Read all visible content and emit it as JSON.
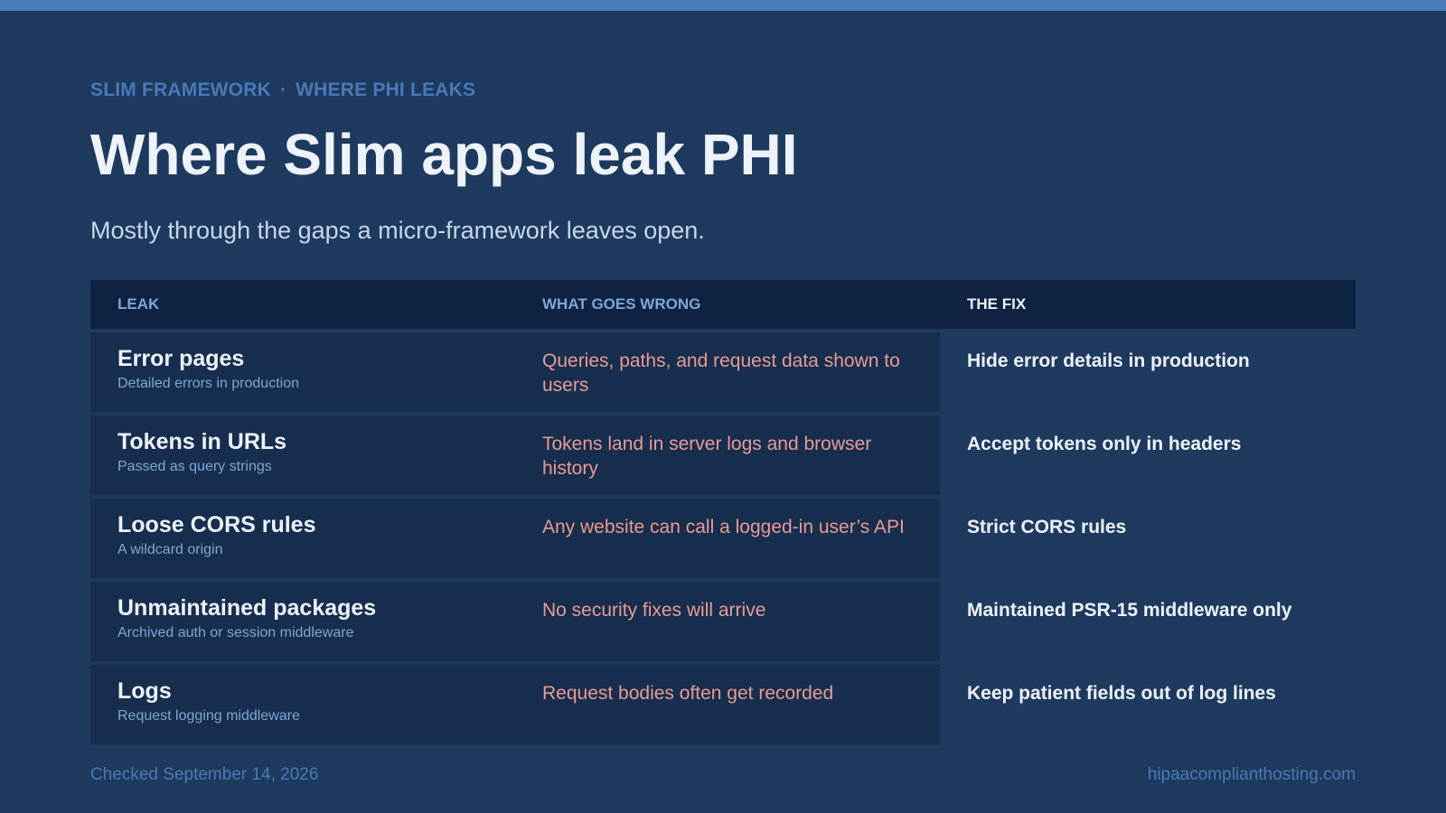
{
  "eyebrow": {
    "left": "SLIM FRAMEWORK",
    "separator": "·",
    "right": "WHERE PHI LEAKS"
  },
  "title": "Where Slim apps leak PHI",
  "subtitle": "Mostly through the gaps a micro-framework leaves open.",
  "table": {
    "headers": [
      "LEAK",
      "WHAT GOES WRONG",
      "THE FIX"
    ],
    "rows": [
      {
        "leak": "Error pages",
        "leak_detail": "Detailed errors in production",
        "problem": "Queries, paths, and request data shown to users",
        "fix": "Hide error details in production"
      },
      {
        "leak": "Tokens in URLs",
        "leak_detail": "Passed as query strings",
        "problem": "Tokens land in server logs and browser history",
        "fix": "Accept tokens only in headers"
      },
      {
        "leak": "Loose CORS rules",
        "leak_detail": "A wildcard origin",
        "problem": "Any website can call a logged-in user’s API",
        "fix": "Strict CORS rules"
      },
      {
        "leak": "Unmaintained packages",
        "leak_detail": "Archived auth or session middleware",
        "problem": "No security fixes will arrive",
        "fix": "Maintained PSR-15 middleware only"
      },
      {
        "leak": "Logs",
        "leak_detail": "Request logging middleware",
        "problem": "Request bodies often get recorded",
        "fix": "Keep patient fields out of log lines"
      }
    ]
  },
  "footer": {
    "checked": "Checked September 14, 2026",
    "site": "hipaacomplianthosting.com"
  },
  "colors": {
    "background": "#1e3a5f",
    "accent": "#4a7ab8",
    "problem_text": "#e89a94",
    "header_bg": "#0e2341"
  }
}
